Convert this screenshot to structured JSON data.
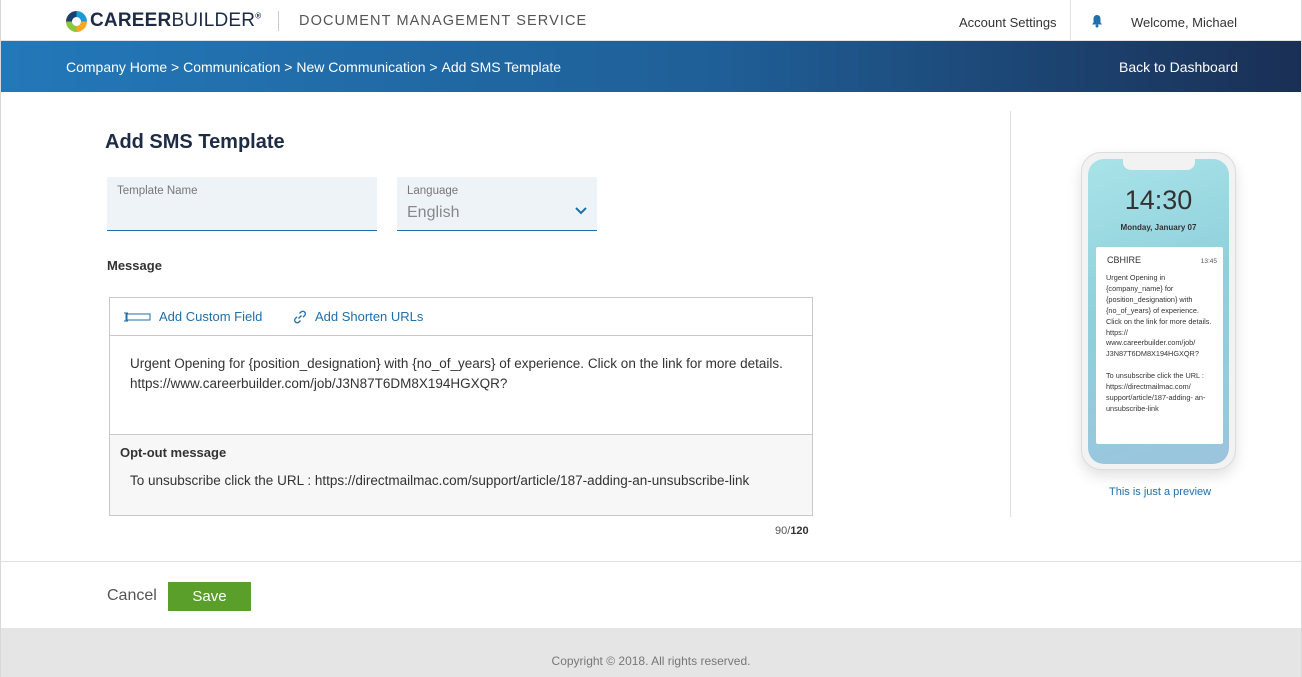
{
  "header": {
    "logo_text_bold": "CAREER",
    "logo_text_light": "BUILDER",
    "logo_reg": "®",
    "service_title": "DOCUMENT MANAGEMENT SERVICE",
    "account_settings": "Account Settings",
    "welcome": "Welcome, Michael",
    "bell_icon": "bell-icon"
  },
  "breadcrumb": {
    "items": [
      "Company Home",
      "Communication",
      "New Communication",
      "Add SMS Template"
    ],
    "separator": " > ",
    "back_to_dashboard": "Back to Dashboard"
  },
  "form": {
    "title": "Add SMS Template",
    "template_name": {
      "label": "Template Name",
      "value": ""
    },
    "language": {
      "label": "Language",
      "value": "English"
    },
    "message_label": "Message",
    "tools": {
      "custom_field": "Add Custom Field",
      "shorten_urls": "Add Shorten URLs"
    },
    "message_line1": "Urgent Opening for {position_designation} with {no_of_years} of experience. Click on the link for more details.",
    "message_line2": "https://www.careerbuilder.com/job/J3N87T6DM8X194HGXQR?",
    "optout_label": "Opt-out message",
    "optout_text": "To unsubscribe click the URL : https://directmailmac.com/support/article/187-adding-an-unsubscribe-link",
    "counter_used": "90",
    "counter_sep": "/",
    "counter_max": "120"
  },
  "preview": {
    "time": "14:30",
    "date": "Monday, January 07",
    "app_name": "CBHIRE",
    "notif_time": "13:45",
    "body_main": "Urgent Opening in {company_name} for {position_designation} with {no_of_years} of experience. Click on the link for more details.",
    "body_url": "https:// www.careerbuilder.com/job/ J3N87T6DM8X194HGXQR?",
    "body_optout": "To unsubscribe click the URL : https://directmailmac.com/ support/article/187-adding- an-unsubscribe-link",
    "note": "This is just a preview"
  },
  "actions": {
    "cancel": "Cancel",
    "save": "Save"
  },
  "footer": {
    "copyright": "Copyright © 2018. All rights reserved."
  },
  "colors": {
    "primary_blue": "#1f6fa8",
    "save_green": "#5b9f2b",
    "title_navy": "#1d2c44"
  }
}
